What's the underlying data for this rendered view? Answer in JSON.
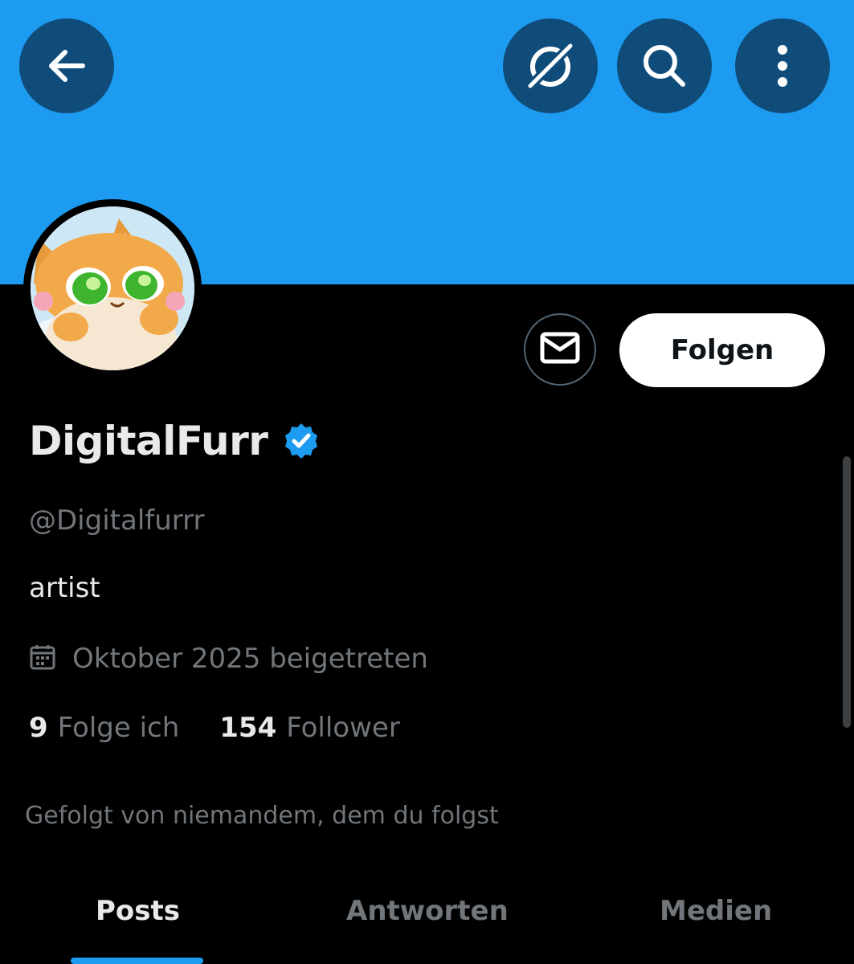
{
  "header": {
    "back_icon": "arrow-left-icon",
    "grok_icon": "grok-icon",
    "search_icon": "search-icon",
    "more_icon": "more-vertical-icon",
    "banner_color": "#1d9bf0",
    "button_color": "#0f4c7a"
  },
  "profile": {
    "display_name": "DigitalFurr",
    "verified": true,
    "verified_color": "#1d9bf0",
    "handle": "@Digitalfurrr",
    "bio": "artist",
    "joined": "Oktober 2025 beigetreten",
    "joined_icon": "calendar-icon",
    "following_count": "9",
    "following_label": "Folge ich",
    "followers_count": "154",
    "followers_label": "Follower",
    "followed_by": "Gefolgt von niemandem, dem du folgst"
  },
  "actions": {
    "message_icon": "mail-icon",
    "follow_label": "Folgen"
  },
  "tabs": [
    {
      "label": "Posts",
      "active": true
    },
    {
      "label": "Antworten",
      "active": false
    },
    {
      "label": "Medien",
      "active": false
    }
  ],
  "colors": {
    "background": "#000000",
    "accent": "#1d9bf0",
    "text_primary": "#e7e9ea",
    "text_secondary": "#71767b"
  }
}
